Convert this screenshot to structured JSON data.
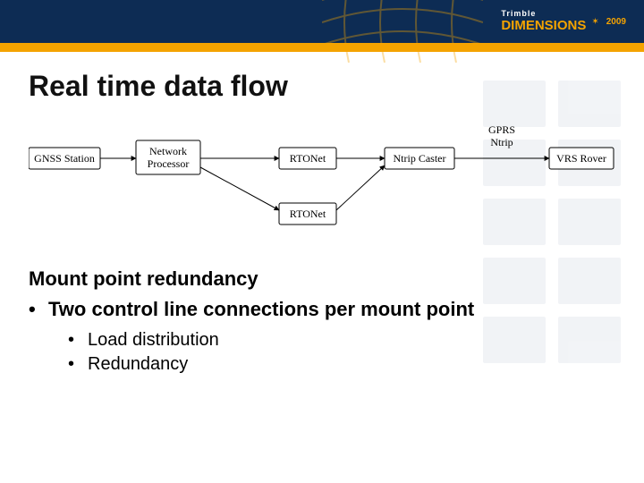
{
  "brand": {
    "company": "Trimble",
    "product": "DIMENSIONS",
    "year": "2009"
  },
  "title": "Real time data flow",
  "diagram": {
    "nodes": {
      "gnss": {
        "label": "GNSS Station"
      },
      "netproc": {
        "label1": "Network",
        "label2": "Processor"
      },
      "rtonet1": {
        "label": "RTONet"
      },
      "rtonet2": {
        "label": "RTONet"
      },
      "caster": {
        "label": "Ntrip Caster"
      },
      "rover": {
        "label": "VRS Rover"
      }
    },
    "edge_label": {
      "line1": "GPRS",
      "line2": "Ntrip"
    }
  },
  "section": {
    "heading": "Mount point redundancy",
    "b1": "Two control line connections per mount point",
    "b2a": "Load distribution",
    "b2b": "Redundancy"
  }
}
